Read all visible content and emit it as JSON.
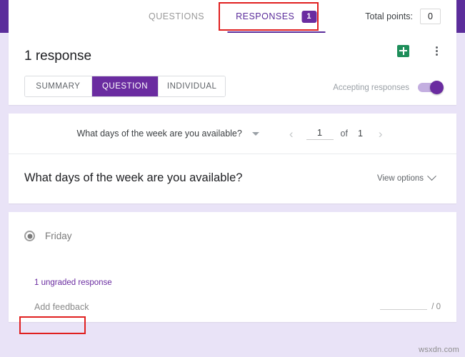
{
  "topbar": {
    "tabs": [
      {
        "label": "QUESTIONS",
        "active": false
      },
      {
        "label": "RESPONSES",
        "active": true,
        "badge": "1"
      }
    ],
    "total_points_label": "Total points:",
    "total_points_value": "0",
    "accent_color": "#5b2d9b"
  },
  "response_header": {
    "response_count": "1 response",
    "view_modes": [
      {
        "label": "SUMMARY",
        "active": false
      },
      {
        "label": "QUESTION",
        "active": true
      },
      {
        "label": "INDIVIDUAL",
        "active": false
      }
    ],
    "sheets_icon": "google-sheets-icon",
    "more_icon": "kebab-menu-icon",
    "accepting_label": "Accepting responses",
    "accepting_state": "on",
    "toggle_color": "#6a2ca0"
  },
  "question_nav": {
    "selected_question": "What days of the week are you available?",
    "dropdown_icon": "caret-down-icon",
    "prev_icon": "chevron-left-icon",
    "next_icon": "chevron-right-icon",
    "current_page": "1",
    "of_label": "of",
    "total_pages": "1"
  },
  "question_block": {
    "title": "What days of the week are you available?",
    "view_options_label": "View options",
    "view_options_icon": "chevron-down-icon"
  },
  "answer_block": {
    "selected_option": "Friday",
    "radio_icon": "radio-selected-icon",
    "ungraded_text": "1 ungraded response",
    "ungraded_color": "#6a2ca0",
    "add_feedback_label": "Add feedback",
    "score_value": "",
    "score_total": "/ 0"
  },
  "annotations": {
    "color": "#e02020",
    "responses_tab_highlight": "RESPONSES",
    "add_feedback_highlight": "Add feedback"
  },
  "watermark": "wsxdn.com"
}
